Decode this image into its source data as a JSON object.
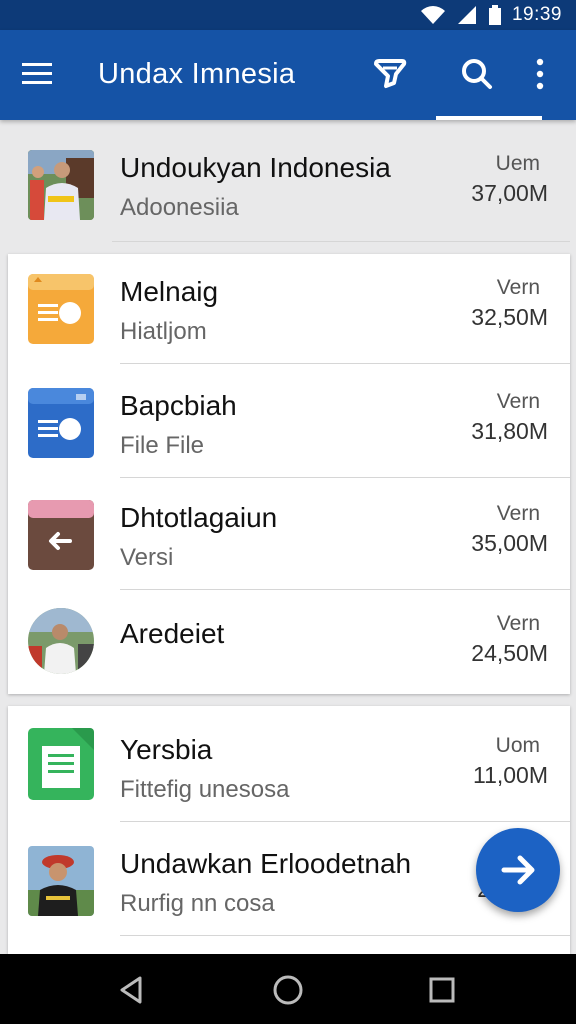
{
  "status_bar": {
    "time": "19:39"
  },
  "app_bar": {
    "title": "Undax Imnesia"
  },
  "header_item": {
    "name": "Undoukyan Indonesia",
    "subtitle": "Adoonesiia",
    "version_label": "Uem",
    "size": "37,00M"
  },
  "group_one": [
    {
      "name": "Melnaig",
      "subtitle": "Hiatljom",
      "version_label": "Vern",
      "size": "32,50M",
      "icon": "orange-folder-icon"
    },
    {
      "name": "Bapcbiah",
      "subtitle": "File File",
      "version_label": "Vern",
      "size": "31,80M",
      "icon": "blue-folder-icon"
    },
    {
      "name": "Dhtotlagaiun",
      "subtitle": "Versi",
      "version_label": "Vern",
      "size": "35,00M",
      "icon": "brown-folder-icon"
    },
    {
      "name": "Aredeiet",
      "subtitle": "",
      "version_label": "Vern",
      "size": "24,50M",
      "icon": "avatar-photo"
    }
  ],
  "group_two": [
    {
      "name": "Yersbia",
      "subtitle": "Fittefig unesosa",
      "version_label": "Uom",
      "size": "11,00M",
      "icon": "green-document-icon"
    },
    {
      "name": "Undawkan Erloodetnah",
      "subtitle": "Rurfig nn cosa",
      "version_label": "",
      "size": "2",
      "icon": "person-photo"
    }
  ],
  "colors": {
    "status_bar": "#0d3a78",
    "app_bar": "#1553a6",
    "fab": "#1c62c4",
    "orange": "#f5a93a",
    "blue": "#2d6cc8",
    "brown": "#6b4a3e",
    "pink": "#e79ab0",
    "green": "#35b45c"
  }
}
